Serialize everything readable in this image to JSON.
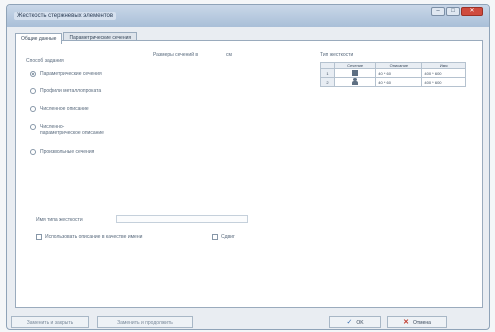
{
  "window": {
    "title": "Жесткость стержневых элементов",
    "minimize_glyph": "–",
    "maximize_glyph": "□",
    "close_glyph": "✕"
  },
  "tabs": [
    {
      "label": "Общие данные",
      "active": true
    },
    {
      "label": "Параметрические сечения",
      "active": false
    }
  ],
  "method": {
    "heading": "Способ задания",
    "options": [
      {
        "label": "Параметрические сечения",
        "selected": true
      },
      {
        "label": "Профили металлопроката",
        "selected": false
      },
      {
        "label": "Численное описание",
        "selected": false
      },
      {
        "label": "Численно-параметрическое описание",
        "selected": false
      },
      {
        "label": "Произвольные сечения",
        "selected": false
      }
    ]
  },
  "dimensions": {
    "label": "Размеры сечений в",
    "unit": "см"
  },
  "stiffness_types": {
    "heading": "Тип жесткости",
    "columns": [
      "",
      "Сечение",
      "Описание",
      "Имя"
    ],
    "rows": [
      {
        "num": "1",
        "icon": "rect-section-icon",
        "description": "40 * 60",
        "name": "400 * 600"
      },
      {
        "num": "2",
        "icon": "person-section-icon",
        "description": "40 * 60",
        "name": "400 * 600"
      }
    ]
  },
  "type_name": {
    "label": "Имя типа жесткости",
    "value": ""
  },
  "options": {
    "use_description": "Использовать описание в качестве имени",
    "shift": "Сдвиг"
  },
  "buttons": {
    "replace_close": "Заменить и закрыть",
    "replace_continue": "Заменить и продолжить",
    "ok": "OK",
    "ok_glyph": "✓",
    "cancel": "Отмена",
    "cancel_glyph": "✕"
  },
  "colors": {
    "accent": "#3a6fb0",
    "cancel": "#c0392b"
  }
}
